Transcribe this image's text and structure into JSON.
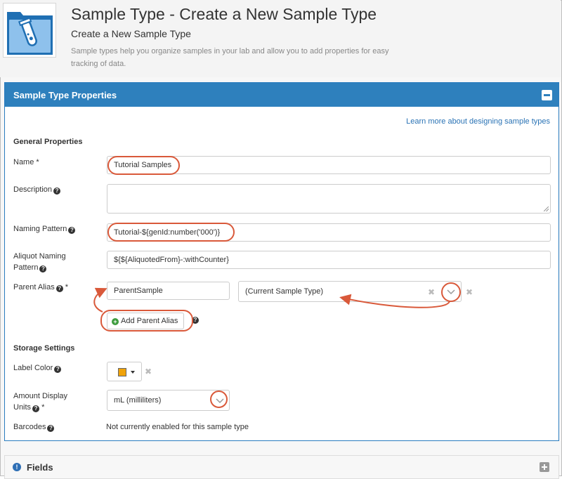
{
  "header": {
    "icon": "sample-folder-icon",
    "title": "Sample Type - Create a New Sample Type",
    "subtitle": "Create a New Sample Type",
    "description": "Sample types help you organize samples in your lab and allow you to add properties for easy tracking of data."
  },
  "panel": {
    "title": "Sample Type Properties",
    "learn_more": "Learn more about designing sample types",
    "general_heading": "General Properties",
    "storage_heading": "Storage Settings"
  },
  "fields": {
    "name": {
      "label": "Name *",
      "value": "Tutorial Samples"
    },
    "description": {
      "label": "Description",
      "value": ""
    },
    "naming_pattern": {
      "label": "Naming Pattern",
      "value": "Tutorial-${genId:number('000')}"
    },
    "aliquot_pattern": {
      "label_line1": "Aliquot Naming",
      "label_line2": "Pattern",
      "value": "${${AliquotedFrom}-:withCounter}"
    },
    "parent_alias": {
      "label": "Parent Alias",
      "required": "*",
      "alias_value": "ParentSample",
      "type_value": "(Current Sample Type)",
      "add_button": "Add Parent Alias"
    },
    "label_color": {
      "label": "Label Color",
      "color": "#f0a30a"
    },
    "amount_units": {
      "label_line1": "Amount Display",
      "label_line2": "Units",
      "required": "*",
      "value": "mL (milliliters)"
    },
    "barcodes": {
      "label": "Barcodes",
      "value": "Not currently enabled for this sample type"
    }
  },
  "fields_panel": {
    "title": "Fields"
  },
  "colors": {
    "accent": "#2e80bd",
    "callout": "#d9593a"
  }
}
